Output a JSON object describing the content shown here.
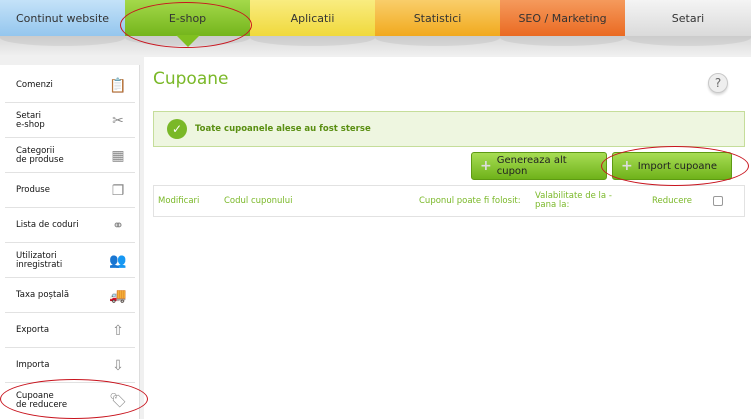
{
  "topnav": {
    "tabs": [
      {
        "label": "Continut website",
        "color": "#a8d4f4"
      },
      {
        "label": "E-shop",
        "color": "#86c42a",
        "active": true
      },
      {
        "label": "Aplicatii",
        "color": "#f5e358"
      },
      {
        "label": "Statistici",
        "color": "#f6b734"
      },
      {
        "label": "SEO / Marketing",
        "color": "#ef7a36"
      },
      {
        "label": "Setari",
        "color": "#e7e7e7"
      }
    ]
  },
  "sidebar": {
    "items": [
      {
        "label": "Comenzi",
        "icon": "clipboard-icon",
        "glyph": "📋"
      },
      {
        "label": "Setari\ne-shop",
        "icon": "tools-icon",
        "glyph": "✂"
      },
      {
        "label": "Categorii\nde produse",
        "icon": "categories-icon",
        "glyph": "▦"
      },
      {
        "label": "Produse",
        "icon": "products-icon",
        "glyph": "❐"
      },
      {
        "label": "Lista de coduri",
        "icon": "codes-icon",
        "glyph": "⚭"
      },
      {
        "label": "Utilizatori\ninregistrati",
        "icon": "users-icon",
        "glyph": "👥"
      },
      {
        "label": "Taxa poștală",
        "icon": "postage-icon",
        "glyph": "🚚"
      },
      {
        "label": "Exporta",
        "icon": "export-icon",
        "glyph": "⇧"
      },
      {
        "label": "Importa",
        "icon": "import-icon",
        "glyph": "⇩"
      },
      {
        "label": "Cupoane\nde reducere",
        "icon": "coupon-tag-icon",
        "glyph": "🏷"
      }
    ]
  },
  "main": {
    "title": "Cupoane",
    "help_label": "?",
    "alert": {
      "message": "Toate cupoanele alese au fost sterse",
      "icon_glyph": "✓"
    },
    "buttons": {
      "generate_label": "Genereaza alt cupon",
      "import_label": "Import cupoane",
      "plus_glyph": "+"
    },
    "table": {
      "columns": [
        "Modificari",
        "Codul cuponului",
        "Cuponul poate fi folosit:",
        "Valabilitate de la - pana la:",
        "Reducere"
      ]
    }
  },
  "colors": {
    "accent_green": "#7ab828",
    "highlight_red": "#c8141e"
  }
}
